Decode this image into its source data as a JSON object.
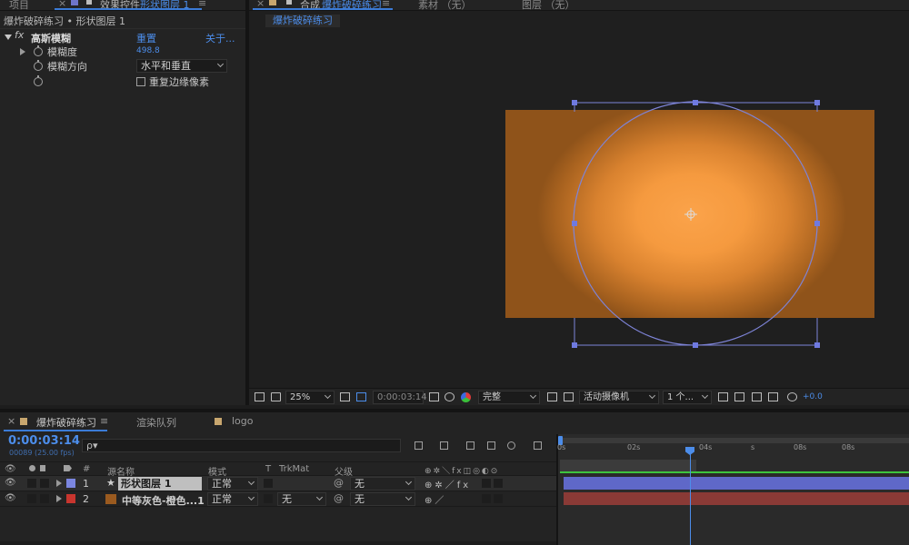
{
  "left_panel": {
    "tab_project": "项目",
    "tab_effect_controls": "效果控件",
    "tab_effect_target": "形状图层 1",
    "breadcrumb": "爆炸破碎练习 • 形状图层 1",
    "effect_name": "高斯模糊",
    "fx_label": "fx",
    "reset_label": "重置",
    "about_label": "关于...",
    "prop_blurriness_label": "模糊度",
    "prop_blurriness_value": "498.8",
    "prop_direction_label": "模糊方向",
    "prop_direction_value": "水平和垂直",
    "repeat_edge_label": "重复边缘像素"
  },
  "viewer": {
    "tab_close": "×",
    "tab_composition_prefix": "合成",
    "tab_composition_name": "爆炸破碎练习",
    "tab_footage": "素材 （无）",
    "tab_layer": "图层 （无）",
    "comp_tab": "爆炸破碎练习",
    "toolbar": {
      "zoom": "25%",
      "timecode": "0:00:03:14",
      "resolution": "完整",
      "camera": "活动摄像机",
      "views": "1 个...",
      "exposure": "+0.0"
    }
  },
  "timeline": {
    "close": "×",
    "tab_comp": "爆炸破碎练习",
    "tab_render": "渲染队列",
    "tab_logo": "logo",
    "timecode": "0:00:03:14",
    "frame_info": "00089 (25.00 fps)",
    "search_placeholder": "ρ▾",
    "columns": {
      "number": "#",
      "source_name": "源名称",
      "mode": "模式",
      "t": "T",
      "trkmat": "TrkMat",
      "parent": "父级"
    },
    "ruler": [
      "0s",
      "02s",
      "04s",
      "s",
      "08s",
      "08s"
    ],
    "layers": [
      {
        "index": "1",
        "name": "形状图层 1",
        "mode": "正常",
        "trkmat": "",
        "parent": "无",
        "color": "#7b86e0"
      },
      {
        "index": "2",
        "name": "中等灰色-橙色...1",
        "mode": "正常",
        "trkmat": "无",
        "parent": "无",
        "color": "#c8352e"
      }
    ]
  },
  "colors": {
    "accent_blue": "#4c8dea",
    "layer1_bar": "#5f68c8",
    "layer2_bar": "#8a3a36",
    "canvas_orange": "#f59a3f"
  }
}
